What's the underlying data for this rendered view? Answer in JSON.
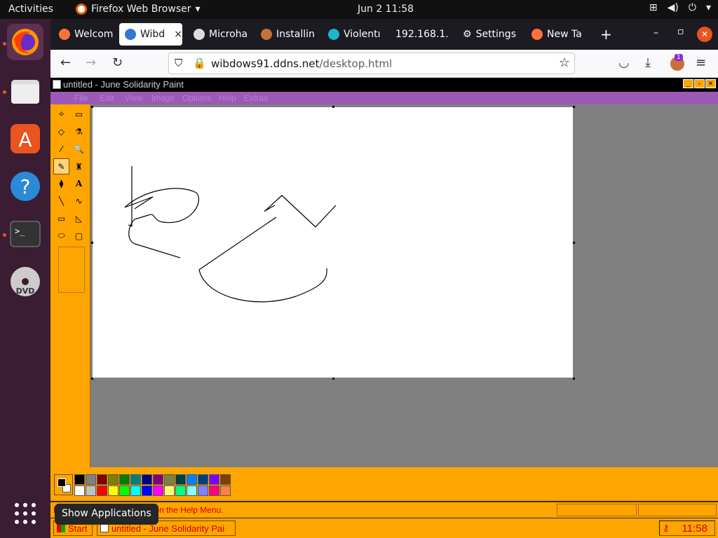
{
  "topbar": {
    "activities": "Activities",
    "app_name": "Firefox Web Browser",
    "clock": "Jun 2  11:58"
  },
  "tabs": [
    "Welcom",
    "Wibd",
    "Microha",
    "Installin",
    "Violentı",
    "192.168.1.",
    "Settings",
    "New Ta"
  ],
  "tab_close": "×",
  "new_tab": "+",
  "window_controls": {
    "minimize": "–",
    "restore": "▫",
    "close": "✕"
  },
  "nav": {
    "back": "←",
    "forward": "→",
    "reload": "↻"
  },
  "address": {
    "host": "wibdows91.ddns.net",
    "path": "/desktop.html"
  },
  "ext_badge": "1",
  "app_window": {
    "title": "untitled - June Solidarity Paint",
    "min": "_",
    "max": "▫",
    "close": "✕"
  },
  "menu": [
    "File",
    "Edit",
    "View",
    "Image",
    "Options",
    "Help",
    "Extras"
  ],
  "tools": [
    "✧",
    "▭",
    "◇",
    "⚗",
    "⁄",
    "🔍",
    "✎",
    "♜",
    "⧫",
    "A",
    "╲",
    "∿",
    "▭",
    "◺",
    "⬭",
    "▢"
  ],
  "palette": {
    "top": [
      "#000000",
      "#808080",
      "#800000",
      "#808000",
      "#008000",
      "#008080",
      "#000080",
      "#800080",
      "#808040",
      "#004040",
      "#0080ff",
      "#004080",
      "#8000ff",
      "#804000"
    ],
    "bottom": [
      "#ffffff",
      "#c0c0c0",
      "#ff0000",
      "#ffff00",
      "#00ff00",
      "#00ffff",
      "#0000ff",
      "#ff00ff",
      "#ffff80",
      "#00ff80",
      "#80ffff",
      "#8080ff",
      "#ff0080",
      "#ff8040"
    ]
  },
  "status_text": "For Help, click Help Topics on the Help Menu.",
  "taskbar": {
    "start": "Start",
    "task": "untitled - June Solidarity Pai",
    "time": "11:58"
  },
  "tooltip": "Show Applications"
}
